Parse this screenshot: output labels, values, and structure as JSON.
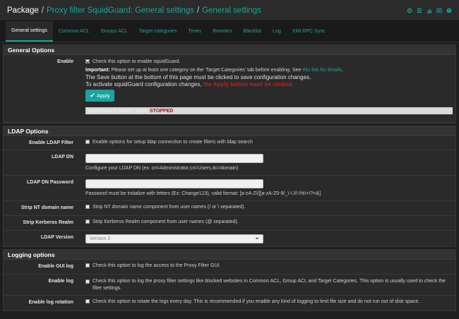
{
  "header": {
    "root": "Package",
    "sep1": "/",
    "link1": "Proxy filter SquidGuard: General settings",
    "sep2": "/",
    "link2": "General settings"
  },
  "top_icons": [
    "settings-icon",
    "sliders-icon",
    "chart-icon",
    "list-icon",
    "help-icon"
  ],
  "tabs": [
    {
      "label": "General settings",
      "active": true
    },
    {
      "label": "Common ACL"
    },
    {
      "label": "Groups ACL"
    },
    {
      "label": "Target categories"
    },
    {
      "label": "Times"
    },
    {
      "label": "Rewrites"
    },
    {
      "label": "Blacklist"
    },
    {
      "label": "Log"
    },
    {
      "label": "XMLRPC Sync"
    }
  ],
  "general": {
    "title": "General Options",
    "enable_label": "Enable",
    "enable_text": "Check this option to enable squidGuard.",
    "important_bold": "Important:",
    "important_text": "Please set up at least one category on the 'Target Categories' tab before enabling. See",
    "important_link": "this link for details",
    "important_end": ".",
    "save_note": "The Save button at the bottom of this page must be clicked to save configuration changes.",
    "activate_note": "To activate squidGuard configuration changes,",
    "activate_red": "the Apply button must be clicked.",
    "apply_label": "Apply",
    "status_label": "SquidGuard service state:",
    "status_value": "STOPPED"
  },
  "ldap": {
    "title": "LDAP Options",
    "filter_label": "Enable LDAP Filter",
    "filter_text": "Enable options for setup ldap connection to create filters with ldap search",
    "dn_label": "LDAP DN",
    "dn_value": "",
    "dn_help": "Configure your LDAP DN (ex: cn=Administrator,cn=Users,dc=domain)",
    "pw_label": "LDAP DN Password",
    "pw_value": "",
    "pw_help": "Password must be initialize with letters (Ex: Change123), valid format: [a-zA-Z\\/][a-zA-Z0-9/_\\-\\.\\/\\:\\%\\+\\?=&]",
    "nt_label": "Strip NT domain name",
    "nt_text": "Strip NT domain name component from user names (/ or \\ separated).",
    "krb_label": "Strip Kerberos Realm",
    "krb_text": "Strip Kerberos Realm component from user names (@ separated).",
    "ver_label": "LDAP Version",
    "ver_value": "Version 3"
  },
  "logging": {
    "title": "Logging options",
    "gui_label": "Enable GUI log",
    "gui_text": "Check this option to log the access to the Proxy Filter GUI.",
    "log_label": "Enable log",
    "log_text": "Check this option to log the proxy filter settings like blocked websites in Common ACL, Group ACL and Target Categories. This option is usually used to check the filter settings.",
    "rot_label": "Enable log rotation",
    "rot_text": "Check this option to rotate the logs every day. This is recommended if you enable any kind of logging to limit file size and do not run out of disk space."
  },
  "colors": {
    "accent": "#1ba39c",
    "stopped": "#a01010",
    "apply_red": "#cc1c1c"
  }
}
